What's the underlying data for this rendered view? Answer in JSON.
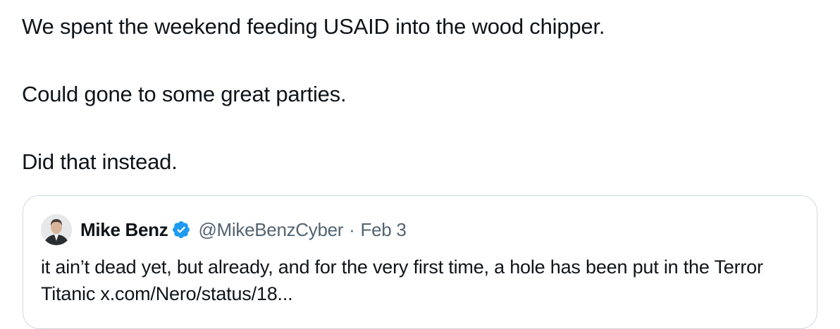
{
  "tweet": {
    "lines": [
      "We spent the weekend feeding USAID into the wood chipper.",
      "Could gone to some great parties.",
      "Did that instead."
    ]
  },
  "quoted_tweet": {
    "author_name": "Mike Benz",
    "author_handle": "@MikeBenzCyber",
    "separator": "·",
    "date": "Feb 3",
    "text": "it ain’t dead yet, but already, and for the very first time, a hole has been put in the Terror Titanic x.com/Nero/status/18...",
    "verified_icon": "verified-badge-icon",
    "avatar_icon": "profile-photo"
  },
  "colors": {
    "text_primary": "#0f1419",
    "text_secondary": "#536471",
    "verified_blue": "#1d9bf0",
    "card_border": "#cfd9de"
  }
}
